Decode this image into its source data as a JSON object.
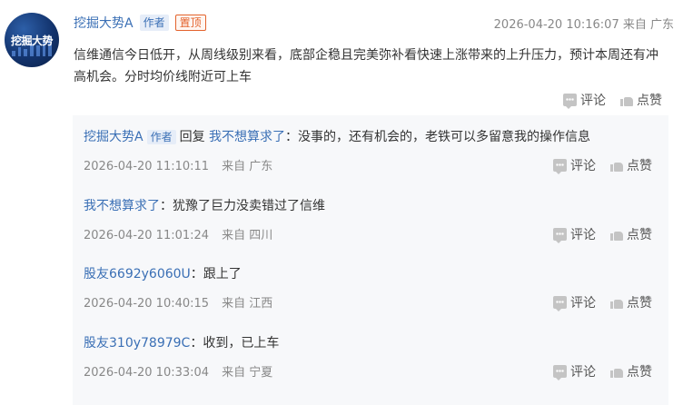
{
  "main": {
    "avatar_text": "挖掘大势",
    "author": "挖掘大势A",
    "author_badge": "作者",
    "pin_badge": "置顶",
    "timestamp": "2026-04-20 10:16:07 来自 广东",
    "text": "信维通信今日低开，从周线级别来看，底部企稳且完美弥补看快速上涨带来的上升压力，预计本周还有冲高机会。分时均价线附近可上车",
    "comment_label": "评论",
    "like_label": "点赞"
  },
  "replies": [
    {
      "user": "挖掘大势A",
      "badge": "作者",
      "reply_word": "回复",
      "reply_to": "我不想算求了",
      "separator": "：",
      "text": "没事的，还有机会的，老铁可以多留意我的操作信息",
      "time": "2026-04-20 11:10:11",
      "location": "来自 广东",
      "comment_label": "评论",
      "like_label": "点赞"
    },
    {
      "user": "我不想算求了",
      "separator": "：",
      "text": "犹豫了巨力没卖错过了信维",
      "time": "2026-04-20 11:01:24",
      "location": "来自 四川",
      "comment_label": "评论",
      "like_label": "点赞"
    },
    {
      "user": "股友6692y6060U",
      "separator": "：",
      "text": "跟上了",
      "time": "2026-04-20 10:40:15",
      "location": "来自 江西",
      "comment_label": "评论",
      "like_label": "点赞"
    },
    {
      "user": "股友310y78979C",
      "separator": "：",
      "text": "收到，已上车",
      "time": "2026-04-20 10:33:04",
      "location": "来自 宁夏",
      "comment_label": "评论",
      "like_label": "点赞"
    }
  ],
  "colors": {
    "link": "#3a6fb5",
    "pin": "#e3632d",
    "meta": "#888888",
    "panel_bg": "#f7f8fa"
  },
  "icons": [
    "comment-icon",
    "like-icon"
  ]
}
